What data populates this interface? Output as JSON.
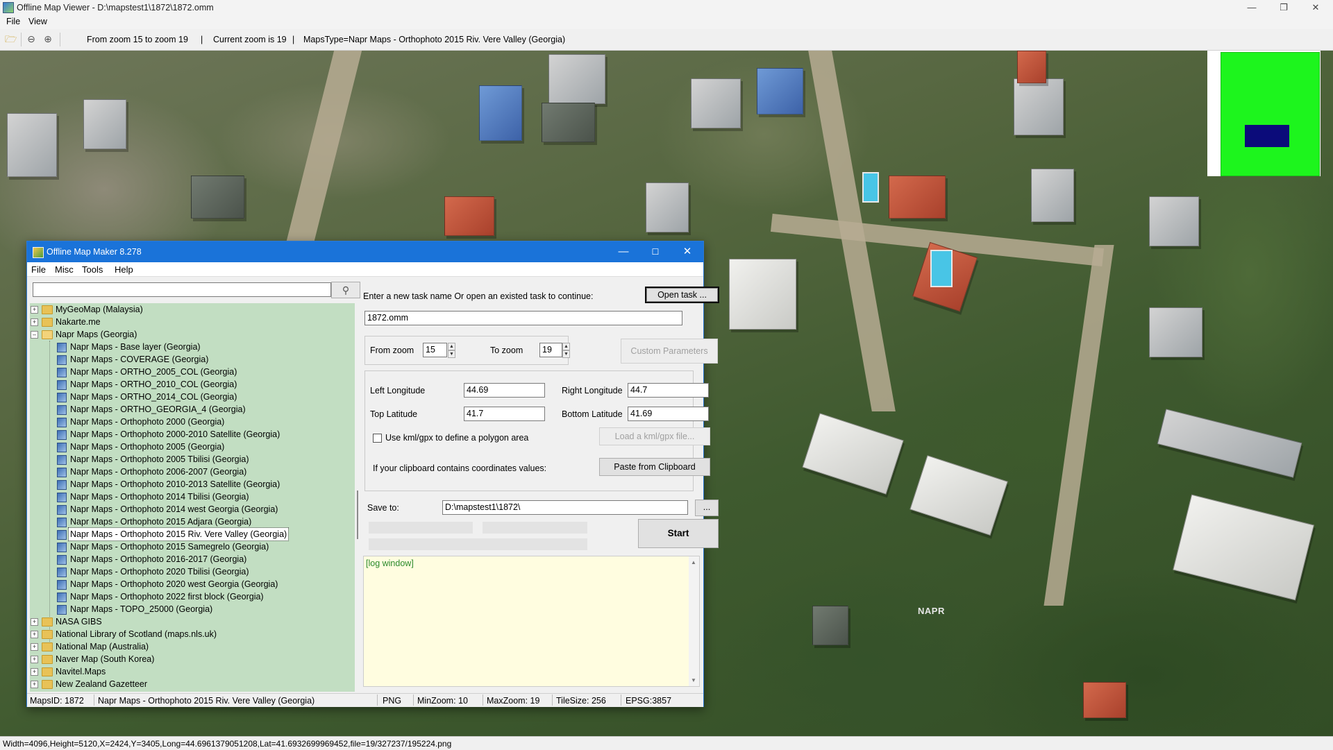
{
  "window": {
    "title": "Offline Map Viewer - D:\\mapstest1\\1872\\1872.omm"
  },
  "menu": [
    "File",
    "View"
  ],
  "toolbar": {
    "zoom_range": "From zoom 15 to zoom 19",
    "current_zoom": "Current zoom is 19",
    "maps_type": "MapsType=Napr Maps - Orthophoto 2015 Riv. Vere Valley (Georgia)",
    "sep1": "|",
    "sep2": "|"
  },
  "map": {
    "watermark": "NAPR"
  },
  "statusbar": "Width=4096,Height=5120,X=2424,Y=3405,Long=44.6961379051208,Lat=41.6932699969452,file=19/327237/195224.png",
  "dialog": {
    "title": "Offline Map Maker 8.278",
    "menu": [
      "File",
      "Misc",
      "Tools",
      "Help"
    ],
    "search_value": "",
    "tree": {
      "top_folders": [
        {
          "label": "MyGeoMap (Malaysia)",
          "expanded": false
        },
        {
          "label": "Nakarte.me",
          "expanded": false
        },
        {
          "label": "Napr Maps (Georgia)",
          "expanded": true
        }
      ],
      "napr_items": [
        "Napr Maps - Base layer (Georgia)",
        "Napr Maps - COVERAGE (Georgia)",
        "Napr Maps - ORTHO_2005_COL (Georgia)",
        "Napr Maps - ORTHO_2010_COL (Georgia)",
        "Napr Maps - ORTHO_2014_COL (Georgia)",
        "Napr Maps - ORTHO_GEORGIA_4 (Georgia)",
        "Napr Maps - Orthophoto 2000 (Georgia)",
        "Napr Maps - Orthophoto 2000-2010 Satellite (Georgia)",
        "Napr Maps - Orthophoto 2005 (Georgia)",
        "Napr Maps - Orthophoto 2005 Tbilisi (Georgia)",
        "Napr Maps - Orthophoto 2006-2007 (Georgia)",
        "Napr Maps - Orthophoto 2010-2013 Satellite (Georgia)",
        "Napr Maps - Orthophoto 2014 Tbilisi (Georgia)",
        "Napr Maps - Orthophoto 2014 west Georgia (Georgia)",
        "Napr Maps - Orthophoto 2015 Adjara (Georgia)",
        "Napr Maps - Orthophoto 2015 Riv. Vere Valley (Georgia)",
        "Napr Maps - Orthophoto 2015 Samegrelo (Georgia)",
        "Napr Maps - Orthophoto 2016-2017 (Georgia)",
        "Napr Maps - Orthophoto 2020 Tbilisi (Georgia)",
        "Napr Maps - Orthophoto 2020 west Georgia (Georgia)",
        "Napr Maps - Orthophoto 2022 first block (Georgia)",
        "Napr Maps - TOPO_25000 (Georgia)"
      ],
      "selected_item": "Napr Maps - Orthophoto 2015 Riv. Vere Valley (Georgia)",
      "bottom_folders": [
        "NASA GIBS",
        "National Library of Scotland (maps.nls.uk)",
        "National Map (Australia)",
        "Naver Map (South Korea)",
        "Navitel.Maps",
        "New Zealand Gazetteer"
      ]
    },
    "task": {
      "prompt": "Enter a new task name Or open an existed task to continue:",
      "open_button": "Open task ...",
      "task_name": "1872.omm"
    },
    "zoom": {
      "from_label": "From zoom",
      "from_value": "15",
      "to_label": "To zoom",
      "to_value": "19",
      "custom_button": "Custom Parameters"
    },
    "bounds": {
      "left_label": "Left Longitude",
      "left_value": "44.69",
      "right_label": "Right Longitude",
      "right_value": "44.7",
      "top_label": "Top Latitude",
      "top_value": "41.7",
      "bottom_label": "Bottom Latitude",
      "bottom_value": "41.69",
      "kml_label": "Use kml/gpx to define a polygon area",
      "kml_checked": false,
      "kml_button": "Load a kml/gpx file...",
      "clipboard_label": "If your clipboard contains coordinates values:",
      "clipboard_button": "Paste from Clipboard"
    },
    "save": {
      "label": "Save to:",
      "path": "D:\\mapstest1\\1872\\",
      "browse_button": "..."
    },
    "start_button": "Start",
    "log_text": "[log window]",
    "status": {
      "maps_id": "MapsID: 1872",
      "maps_name": "Napr Maps - Orthophoto 2015 Riv. Vere Valley (Georgia)",
      "format": "PNG",
      "min_zoom": "MinZoom: 10",
      "max_zoom": "MaxZoom: 19",
      "tile_size": "TileSize: 256",
      "epsg": "EPSG:3857"
    }
  }
}
